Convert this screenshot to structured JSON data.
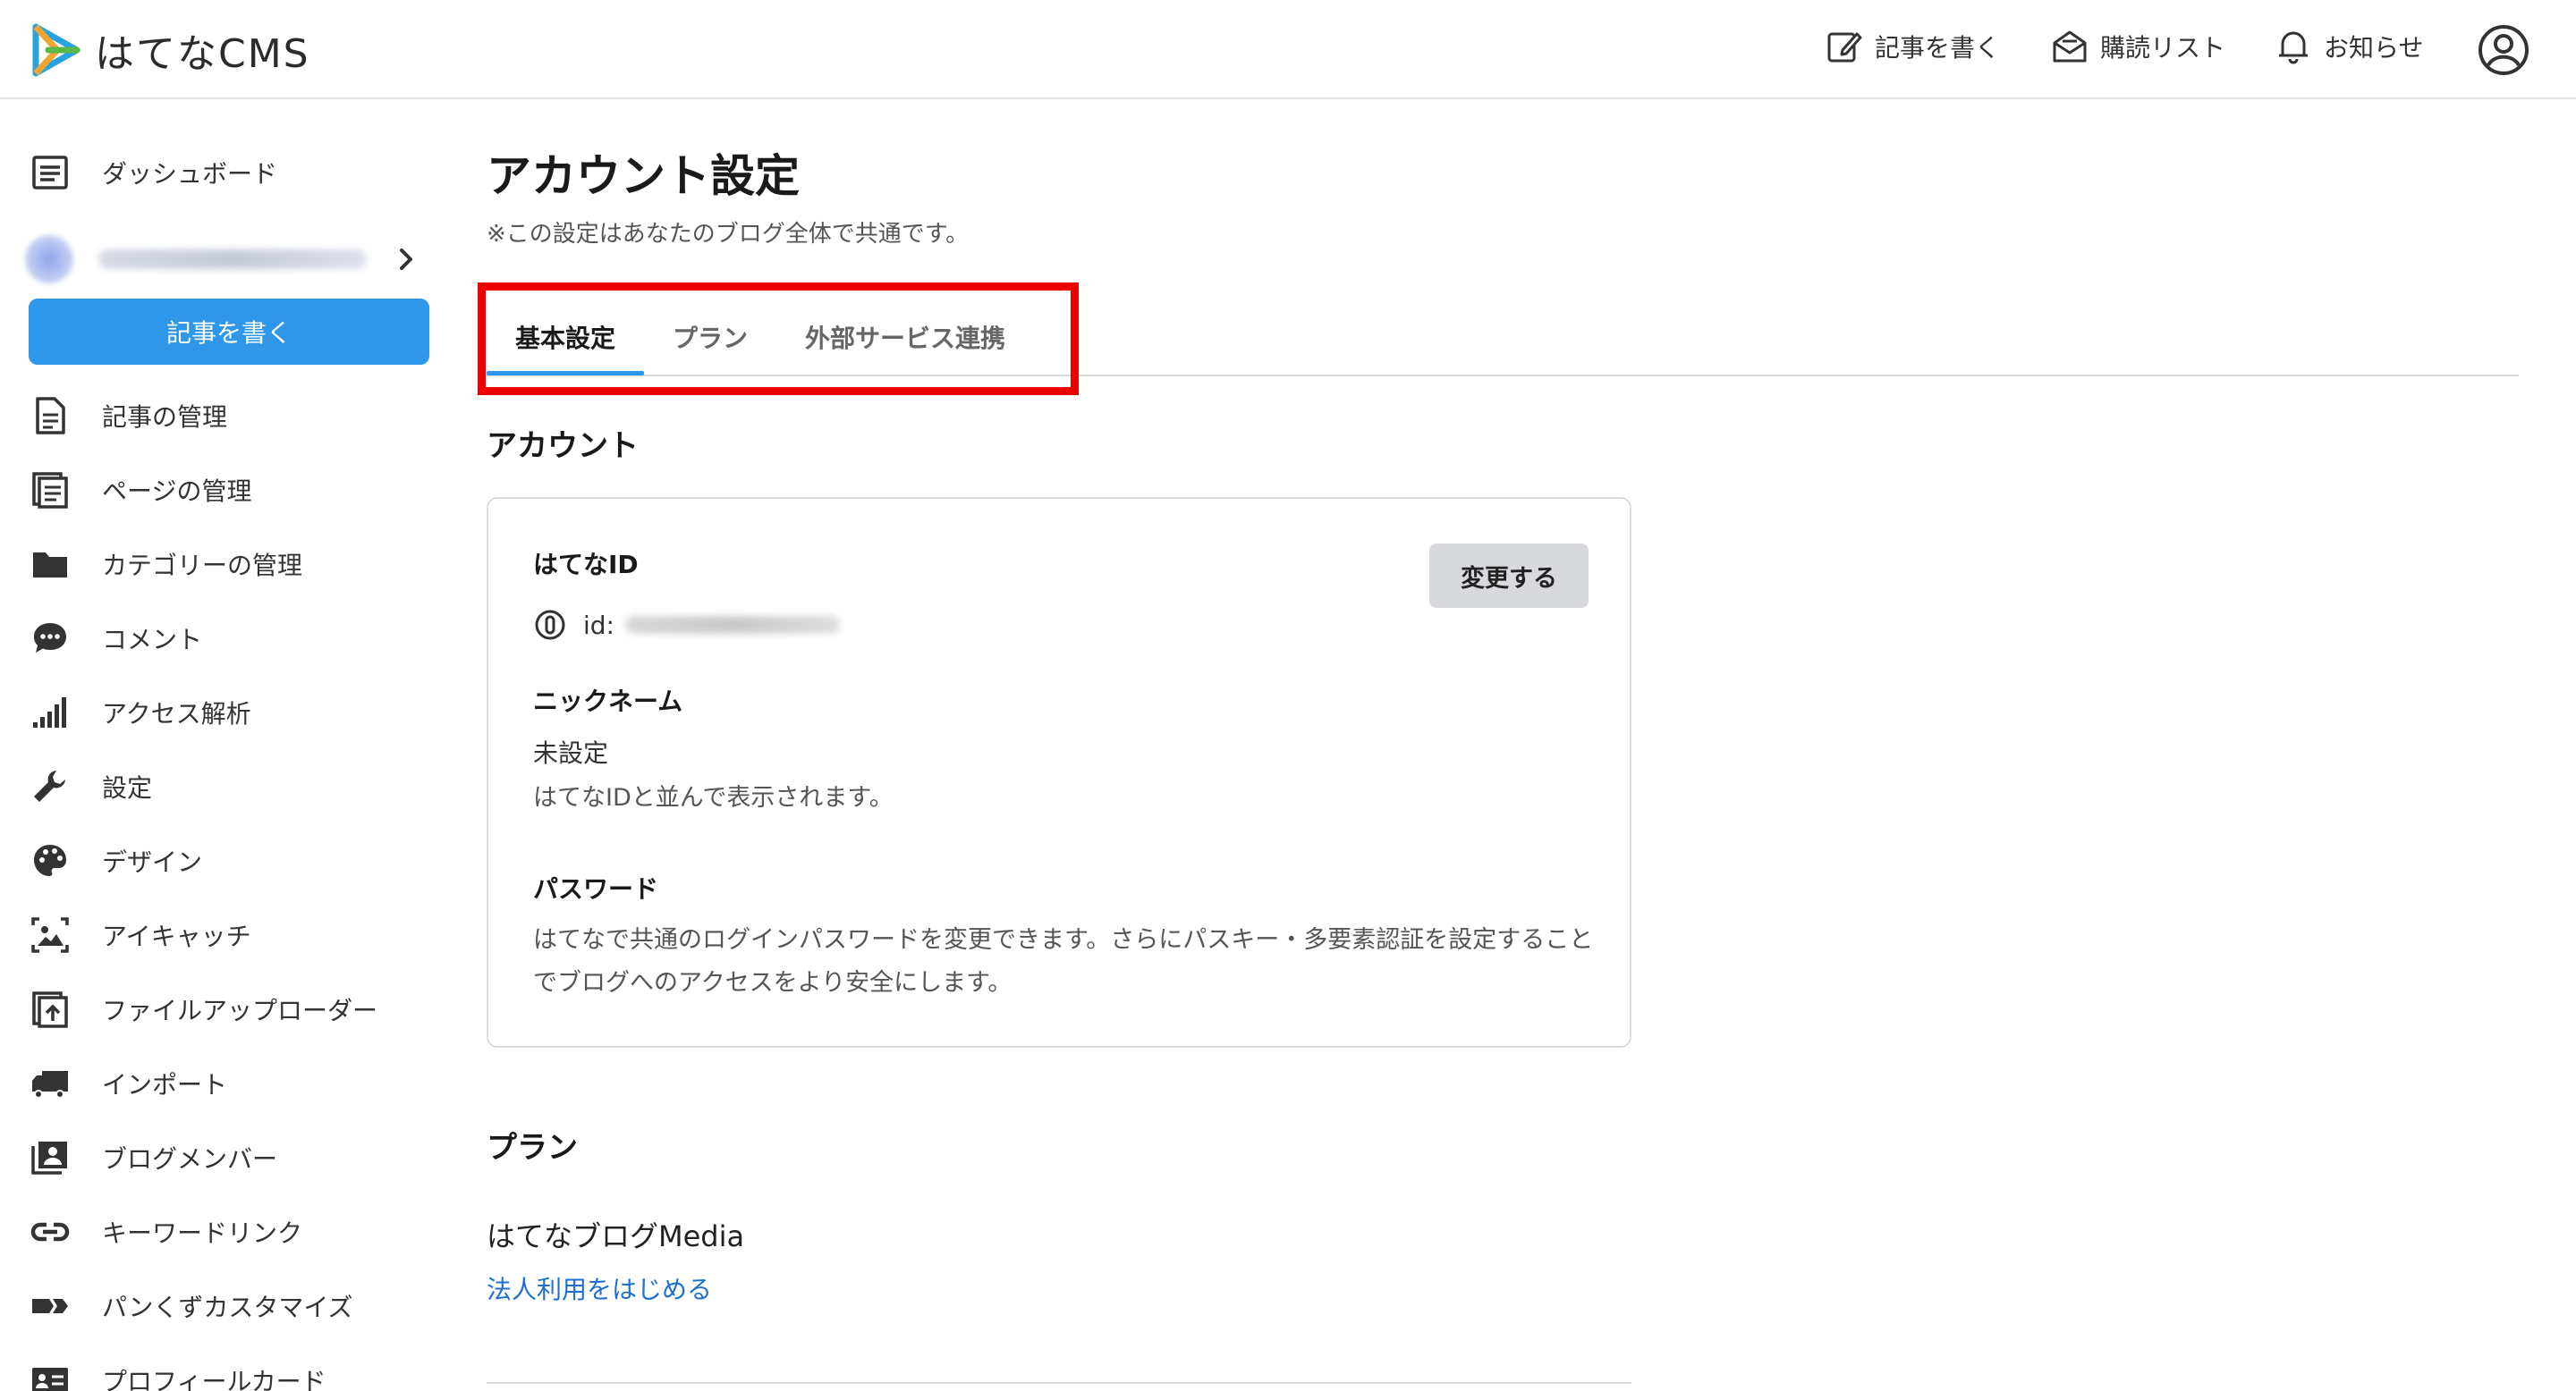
{
  "header": {
    "logo_text": "はてなCMS",
    "write_label": "記事を書く",
    "reading_list_label": "購読リスト",
    "notifications_label": "お知らせ"
  },
  "sidebar": {
    "dashboard": "ダッシュボード",
    "write_button": "記事を書く",
    "items": [
      {
        "label": "記事の管理",
        "icon": "document-icon"
      },
      {
        "label": "ページの管理",
        "icon": "pages-icon"
      },
      {
        "label": "カテゴリーの管理",
        "icon": "folder-icon"
      },
      {
        "label": "コメント",
        "icon": "comment-icon"
      },
      {
        "label": "アクセス解析",
        "icon": "bar-chart-icon"
      },
      {
        "label": "設定",
        "icon": "wrench-icon"
      },
      {
        "label": "デザイン",
        "icon": "palette-icon"
      },
      {
        "label": "アイキャッチ",
        "icon": "image-icon"
      },
      {
        "label": "ファイルアップローダー",
        "icon": "upload-icon"
      },
      {
        "label": "インポート",
        "icon": "truck-icon"
      },
      {
        "label": "ブログメンバー",
        "icon": "members-icon"
      },
      {
        "label": "キーワードリンク",
        "icon": "link-icon"
      },
      {
        "label": "パンくずカスタマイズ",
        "icon": "breadcrumb-icon"
      },
      {
        "label": "プロフィールカード",
        "icon": "profile-card-icon"
      }
    ]
  },
  "page": {
    "title": "アカウント設定",
    "note": "※この設定はあなたのブログ全体で共通です。",
    "tabs": [
      "基本設定",
      "プラン",
      "外部サービス連携"
    ]
  },
  "account": {
    "section_title": "アカウント",
    "hatena_id_label": "はてなID",
    "id_prefix": "id:",
    "change_button": "変更する",
    "nickname_label": "ニックネーム",
    "nickname_value": "未設定",
    "nickname_help": "はてなIDと並んで表示されます。",
    "password_label": "パスワード",
    "password_help": "はてなで共通のログインパスワードを変更できます。さらにパスキー・多要素認証を設定することでブログへのアクセスをより安全にします。"
  },
  "plan": {
    "section_title": "プラン",
    "plan_name": "はてなブログMedia",
    "corporate_link": "法人利用をはじめる"
  },
  "colors": {
    "accent": "#2e97ea",
    "highlight": "#ef0000",
    "link": "#1f6fd1"
  }
}
